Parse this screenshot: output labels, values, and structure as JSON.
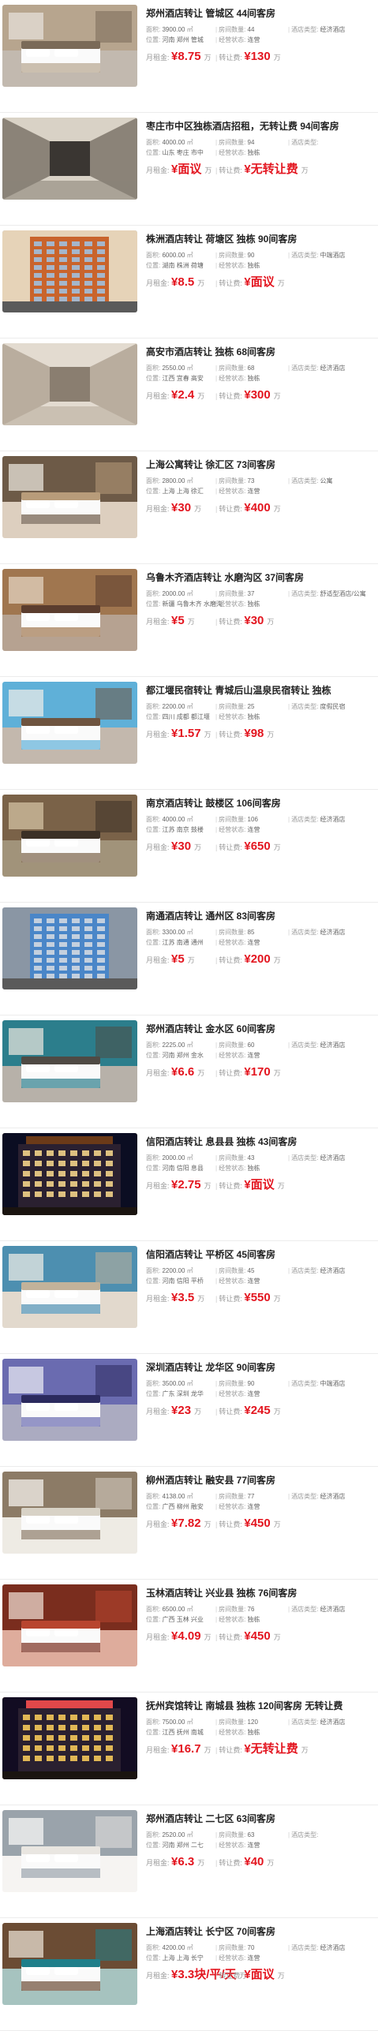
{
  "labels": {
    "area": "面积:",
    "rooms": "房间数量:",
    "type": "酒店类型:",
    "location": "位置:",
    "operation": "经营状态:",
    "rent": "月租金:",
    "transfer": "转让费:",
    "wan": "万",
    "sqm": "㎡"
  },
  "listings": [
    {
      "title": "郑州酒店转让 管城区 44间客房",
      "area": "3900.00",
      "rooms": "44",
      "type": "经济酒店",
      "location": "河南 郑州 管城",
      "status": "连营",
      "rent": "¥8.75",
      "transfer": "¥130",
      "rent_unit": "万",
      "transfer_unit": "万",
      "scene": "bedroom",
      "palette": [
        "#7a6a58",
        "#e8e4de",
        "#b7a58e"
      ]
    },
    {
      "title": "枣庄市中区独栋酒店招租，无转让费 94间客房",
      "area": "4000.00",
      "rooms": "94",
      "type": "",
      "location": "山东 枣庄 市中",
      "status": "独栋",
      "rent": "¥面议",
      "transfer": "¥无转让费",
      "rent_unit": "万",
      "transfer_unit": "万",
      "scene": "lobby",
      "palette": [
        "#3a3632",
        "#d9d2c6",
        "#8b8378"
      ]
    },
    {
      "title": "株洲酒店转让 荷塘区 独栋 90间客房",
      "area": "6000.00",
      "rooms": "90",
      "type": "中端酒店",
      "location": "湖南 株洲 荷塘",
      "status": "独栋",
      "rent": "¥8.5",
      "transfer": "¥面议",
      "rent_unit": "万",
      "transfer_unit": "万",
      "scene": "building",
      "palette": [
        "#c9642c",
        "#9fc4e8",
        "#e6d3b8"
      ]
    },
    {
      "title": "高安市酒店转让 独栋 68间客房",
      "area": "2550.00",
      "rooms": "68",
      "type": "经济酒店",
      "location": "江西 宜春 高安",
      "status": "独栋",
      "rent": "¥2.4",
      "transfer": "¥300",
      "rent_unit": "万",
      "transfer_unit": "万",
      "scene": "corridor",
      "palette": [
        "#8a7e70",
        "#e3dbd0",
        "#b9ad9e"
      ]
    },
    {
      "title": "上海公寓转让 徐汇区 73间客房",
      "area": "2800.00",
      "rooms": "73",
      "type": "公寓",
      "location": "上海 上海 徐汇",
      "status": "连营",
      "rent": "¥30",
      "transfer": "¥400",
      "rent_unit": "万",
      "transfer_unit": "万",
      "scene": "twin",
      "palette": [
        "#b89c7a",
        "#f1ece4",
        "#6d5a47"
      ]
    },
    {
      "title": "乌鲁木齐酒店转让 水磨沟区 37间客房",
      "area": "2000.00",
      "rooms": "37",
      "type": "舒适型酒店/公寓",
      "location": "新疆 乌鲁木齐 水磨沟",
      "status": "独栋",
      "rent": "¥5",
      "transfer": "¥30",
      "rent_unit": "万",
      "transfer_unit": "万",
      "scene": "bedroom2",
      "palette": [
        "#5b3d2e",
        "#e7d9c7",
        "#a0764f"
      ]
    },
    {
      "title": "都江堰民宿转让 青城后山温泉民宿转让 独栋",
      "area": "2200.00",
      "rooms": "25",
      "type": "度假民宿",
      "location": "四川 成都 都江堰",
      "status": "独栋",
      "rent": "¥1.57",
      "transfer": "¥98",
      "rent_unit": "万",
      "transfer_unit": "万",
      "scene": "loft",
      "palette": [
        "#6e5440",
        "#f2efe9",
        "#5fb0d8"
      ]
    },
    {
      "title": "南京酒店转让 鼓楼区 106间客房",
      "area": "4000.00",
      "rooms": "106",
      "type": "经济酒店",
      "location": "江苏 南京 鼓楼",
      "status": "连营",
      "rent": "¥30",
      "transfer": "¥650",
      "rent_unit": "万",
      "transfer_unit": "万",
      "scene": "dim",
      "palette": [
        "#3b3026",
        "#d8c8a8",
        "#7a6248"
      ]
    },
    {
      "title": "南通酒店转让 通州区 83间客房",
      "area": "3300.00",
      "rooms": "85",
      "type": "经济酒店",
      "location": "江苏 南通 通州",
      "status": "连营",
      "rent": "¥5",
      "transfer": "¥200",
      "rent_unit": "万",
      "transfer_unit": "万",
      "scene": "tower",
      "palette": [
        "#4a86c8",
        "#d9dde2",
        "#8a96a4"
      ]
    },
    {
      "title": "郑州酒店转让 金水区 60间客房",
      "area": "2225.00",
      "rooms": "60",
      "type": "经济酒店",
      "location": "河南 郑州 金水",
      "status": "连营",
      "rent": "¥6.6",
      "transfer": "¥170",
      "rent_unit": "万",
      "transfer_unit": "万",
      "scene": "bedroom3",
      "palette": [
        "#4f4a44",
        "#efe9df",
        "#2c7e8c"
      ]
    },
    {
      "title": "信阳酒店转让 息县县 独栋 43间客房",
      "area": "2000.00",
      "rooms": "43",
      "type": "经济酒店",
      "location": "河南 信阳 息县",
      "status": "独栋",
      "rent": "¥2.75",
      "transfer": "¥面议",
      "rent_unit": "万",
      "transfer_unit": "万",
      "scene": "night",
      "palette": [
        "#0b0d22",
        "#f2d38a",
        "#6b3a18"
      ]
    },
    {
      "title": "信阳酒店转让 平桥区 45间客房",
      "area": "2200.00",
      "rooms": "45",
      "type": "经济酒店",
      "location": "河南 信阳 平桥",
      "status": "连营",
      "rent": "¥3.5",
      "transfer": "¥550",
      "rent_unit": "万",
      "transfer_unit": "万",
      "scene": "twin2",
      "palette": [
        "#c2b29a",
        "#f3efe8",
        "#4d8fb0"
      ]
    },
    {
      "title": "深圳酒店转让 龙华区 90间客房",
      "area": "3500.00",
      "rooms": "90",
      "type": "中端酒店",
      "location": "广东 深圳 龙华",
      "status": "连营",
      "rent": "¥23",
      "transfer": "¥245",
      "rent_unit": "万",
      "transfer_unit": "万",
      "scene": "purple",
      "palette": [
        "#2b2a5e",
        "#f0f0f6",
        "#6a6bb0"
      ]
    },
    {
      "title": "柳州酒店转让 融安县 77间客房",
      "area": "4138.00",
      "rooms": "77",
      "type": "经济酒店",
      "location": "广西 柳州 融安",
      "status": "连营",
      "rent": "¥7.82",
      "transfer": "¥450",
      "rent_unit": "万",
      "transfer_unit": "万",
      "scene": "bright",
      "palette": [
        "#d8d2c6",
        "#fbf9f5",
        "#8c7b66"
      ]
    },
    {
      "title": "玉林酒店转让 兴业县 独栋 76间客房",
      "area": "6500.00",
      "rooms": "76",
      "type": "经济酒店",
      "location": "广西 玉林 兴业",
      "status": "独栋",
      "rent": "¥4.09",
      "transfer": "¥450",
      "rent_unit": "万",
      "transfer_unit": "万",
      "scene": "red",
      "palette": [
        "#b8452f",
        "#f3e4d8",
        "#7a2d1e"
      ]
    },
    {
      "title": "抚州宾馆转让 南城县 独栋 120间客房 无转让费",
      "area": "7500.00",
      "rooms": "120",
      "type": "经济酒店",
      "location": "江西 抚州 南城",
      "status": "独栋",
      "rent": "¥16.7",
      "transfer": "¥无转让费",
      "rent_unit": "万",
      "transfer_unit": "万",
      "scene": "night2",
      "palette": [
        "#120c22",
        "#f4c85a",
        "#e0484a"
      ]
    },
    {
      "title": "郑州酒店转让 二七区 63间客房",
      "area": "2520.00",
      "rooms": "63",
      "type": "",
      "location": "河南 郑州 二七",
      "status": "连营",
      "rent": "¥6.3",
      "transfer": "¥40",
      "rent_unit": "万",
      "transfer_unit": "万",
      "scene": "white",
      "palette": [
        "#e9e6e1",
        "#fdfcfb",
        "#9aa3ab"
      ]
    },
    {
      "title": "上海酒店转让 长宁区 70间客房",
      "area": "4200.00",
      "rooms": "70",
      "type": "经济酒店",
      "location": "上海 上海 长宁",
      "status": "连营",
      "rent": "¥3.3块/平/天",
      "transfer": "¥面议",
      "rent_unit": "万",
      "transfer_unit": "万",
      "scene": "teal",
      "palette": [
        "#1f7f8a",
        "#efe8dc",
        "#6b4c34"
      ]
    }
  ]
}
